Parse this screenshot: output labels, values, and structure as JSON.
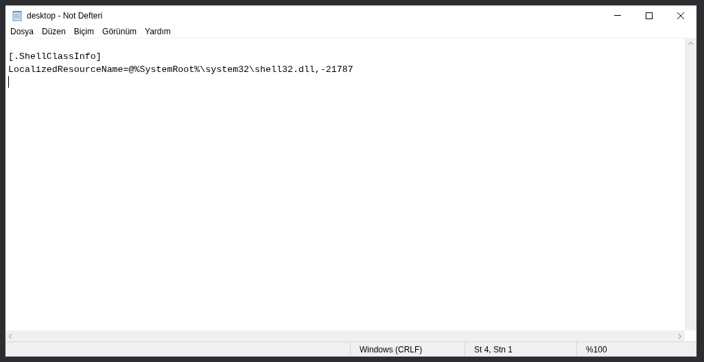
{
  "window": {
    "title": "desktop - Not Defteri"
  },
  "menu": [
    "Dosya",
    "Düzen",
    "Biçim",
    "Görünüm",
    "Yardım"
  ],
  "editor": {
    "lines": [
      "[.ShellClassInfo]",
      "LocalizedResourceName=@%SystemRoot%\\system32\\shell32.dll,-21787"
    ]
  },
  "status_bar": [
    "Windows (CRLF)",
    "St 4, Stn 1",
    "%100"
  ]
}
